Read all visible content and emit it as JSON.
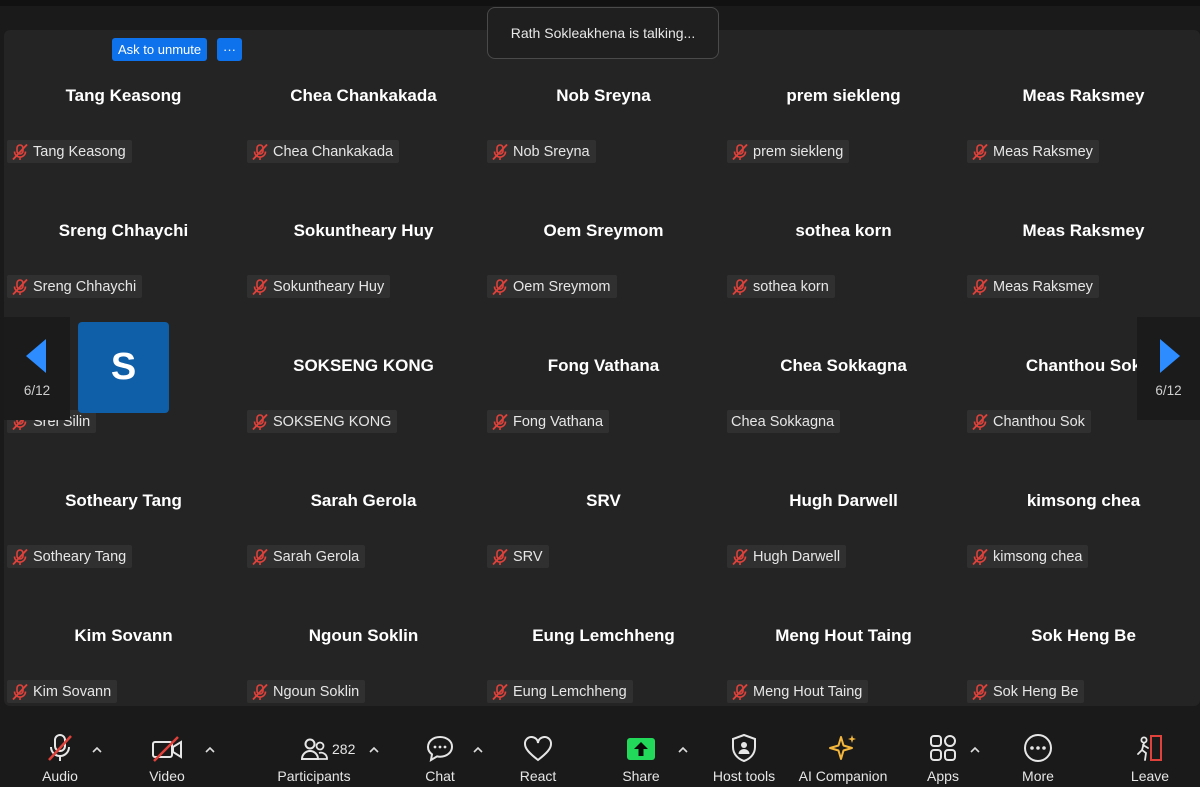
{
  "talk_toast": "Rath Sokleakhena is talking...",
  "ask_unmute_label": "Ask to unmute",
  "ask_more_label": "···",
  "pager": {
    "left_label": "6/12",
    "right_label": "6/12"
  },
  "avatar_letter": "S",
  "tiles": [
    {
      "big": "Tang Keasong",
      "tag": "Tang Keasong",
      "muted": true
    },
    {
      "big": "Chea Chankakada",
      "tag": "Chea Chankakada",
      "muted": true
    },
    {
      "big": "Nob Sreyna",
      "tag": "Nob Sreyna",
      "muted": true
    },
    {
      "big": "prem siekleng",
      "tag": "prem siekleng",
      "muted": true
    },
    {
      "big": "Meas Raksmey",
      "tag": "Meas Raksmey",
      "muted": true
    },
    {
      "big": "Sreng Chhaychi",
      "tag": "Sreng Chhaychi",
      "muted": true
    },
    {
      "big": "Sokuntheary Huy",
      "tag": "Sokuntheary Huy",
      "muted": true
    },
    {
      "big": "Oem Sreymom",
      "tag": "Oem Sreymom",
      "muted": true
    },
    {
      "big": "sothea korn",
      "tag": "sothea korn",
      "muted": true
    },
    {
      "big": "Meas Raksmey",
      "tag": "Meas Raksmey",
      "muted": true
    },
    {
      "big": "",
      "tag": "Srei Silin",
      "muted": true
    },
    {
      "big": "SOKSENG KONG",
      "tag": "SOKSENG KONG",
      "muted": true
    },
    {
      "big": "Fong Vathana",
      "tag": "Fong Vathana",
      "muted": true
    },
    {
      "big": "Chea Sokkagna",
      "tag": "Chea Sokkagna",
      "muted": false
    },
    {
      "big": "Chanthou Sok",
      "tag": "Chanthou Sok",
      "muted": true
    },
    {
      "big": "Sotheary Tang",
      "tag": "Sotheary Tang",
      "muted": true
    },
    {
      "big": "Sarah Gerola",
      "tag": "Sarah Gerola",
      "muted": true
    },
    {
      "big": "SRV",
      "tag": "SRV",
      "muted": true
    },
    {
      "big": "Hugh Darwell",
      "tag": "Hugh Darwell",
      "muted": true
    },
    {
      "big": "kimsong chea",
      "tag": "kimsong chea",
      "muted": true
    },
    {
      "big": "Kim Sovann",
      "tag": "Kim Sovann",
      "muted": true
    },
    {
      "big": "Ngoun Soklin",
      "tag": "Ngoun Soklin",
      "muted": true
    },
    {
      "big": "Eung Lemchheng",
      "tag": "Eung Lemchheng",
      "muted": true
    },
    {
      "big": "Meng Hout Taing",
      "tag": "Meng Hout Taing",
      "muted": true
    },
    {
      "big": "Sok Heng Be",
      "tag": "Sok Heng Be",
      "muted": true
    }
  ],
  "toolbar": {
    "audio": "Audio",
    "video": "Video",
    "participants": "Participants",
    "participants_count": "282",
    "chat": "Chat",
    "react": "React",
    "share": "Share",
    "host_tools": "Host tools",
    "ai_companion": "AI Companion",
    "apps": "Apps",
    "more": "More",
    "leave": "Leave"
  },
  "colors": {
    "accent_blue": "#0e72ed",
    "muted_red": "#e0413a",
    "share_green": "#23d959",
    "ai_gold": "#f5b73b",
    "leave_red": "#e0413a"
  }
}
